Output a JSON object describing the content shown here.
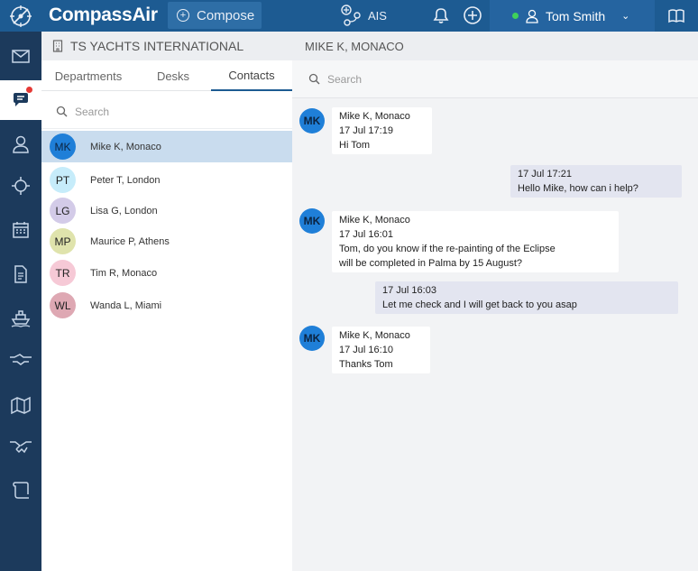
{
  "app": {
    "brand_compass": "Compass",
    "brand_air": "Air",
    "compose_label": "Compose",
    "ais_label": "AIS",
    "user_name": "Tom Smith",
    "status_color": "#3fd15a",
    "accent_color": "#1d5b92"
  },
  "sidebar": {
    "items": [
      {
        "icon": "mail-icon"
      },
      {
        "icon": "chat-icon",
        "active": true,
        "badge": true
      },
      {
        "icon": "person-icon"
      },
      {
        "icon": "helm-icon"
      },
      {
        "icon": "calendar-icon"
      },
      {
        "icon": "document-icon"
      },
      {
        "icon": "ship-icon"
      },
      {
        "icon": "handshake-icon"
      },
      {
        "icon": "map-icon"
      },
      {
        "icon": "deal-icon"
      },
      {
        "icon": "scroll-icon"
      }
    ]
  },
  "panel": {
    "org_name": "TS YACHTS INTERNATIONAL",
    "tabs": [
      {
        "label": "Departments"
      },
      {
        "label": "Desks"
      },
      {
        "label": "Contacts",
        "active": true
      }
    ],
    "search_placeholder": "Search",
    "contacts": [
      {
        "initials": "MK",
        "name": "Mike K, Monaco",
        "color": "#1f7fd8",
        "active": true
      },
      {
        "initials": "PT",
        "name": "Peter T, London",
        "color": "#c6ecfa"
      },
      {
        "initials": "LG",
        "name": "Lisa G, London",
        "color": "#d3cbe8"
      },
      {
        "initials": "MP",
        "name": "Maurice P, Athens",
        "color": "#dfe3ac"
      },
      {
        "initials": "TR",
        "name": "Tim R, Monaco",
        "color": "#f6c9d6"
      },
      {
        "initials": "WL",
        "name": "Wanda L, Miami",
        "color": "#dea8b3"
      }
    ]
  },
  "chat": {
    "title": "MIKE K, MONACO",
    "search_placeholder": "Search",
    "messages": [
      {
        "direction": "in",
        "avatar": "MK",
        "sender": "Mike K, Monaco",
        "time": "17 Jul 17:19",
        "lines": [
          "Hi Tom"
        ]
      },
      {
        "direction": "out",
        "time": "17 Jul 17:21",
        "lines": [
          "Hello Mike, how can i help?"
        ]
      },
      {
        "direction": "in",
        "avatar": "MK",
        "sender": "Mike K, Monaco",
        "time": "17 Jul 16:01",
        "lines": [
          "Tom, do you know if the re-painting of the Eclipse",
          "will be completed in Palma by 15 August?"
        ]
      },
      {
        "direction": "out",
        "time": "17 Jul 16:03",
        "lines": [
          "Let me check and I will get back to you asap"
        ]
      },
      {
        "direction": "in",
        "avatar": "MK",
        "sender": "Mike K, Monaco",
        "time": "17 Jul 16:10",
        "lines": [
          "Thanks Tom"
        ]
      }
    ]
  }
}
